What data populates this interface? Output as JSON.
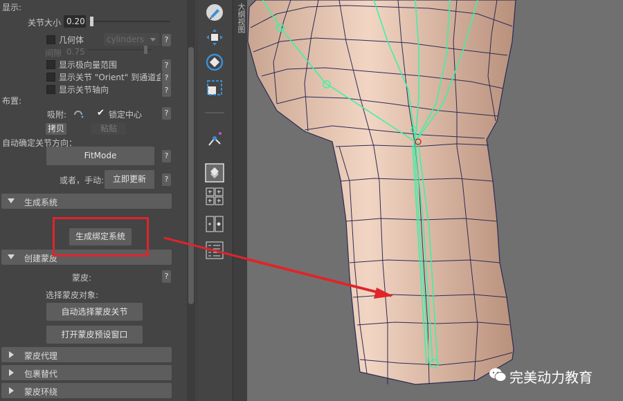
{
  "display": {
    "header": "显示:",
    "joint_size_label": "关节大小",
    "joint_size_value": "0.20",
    "geometry_label": "几何体",
    "geometry_value": "cylinders",
    "gap_label": "间隙",
    "gap_value": "0.75",
    "show_pole_label": "显示极向量范围",
    "show_orient_label": "显示关节 \"Orient\" 到通道盒",
    "show_axis_label": "显示关节轴向"
  },
  "layout": {
    "header": "布置:",
    "snap_label": "吸附:",
    "lock_center_label": "锁定中心",
    "copy_label": "拷贝",
    "paste_label": "粘贴"
  },
  "auto_orient": {
    "header": "自动确定关节方向：",
    "fitmode_label": "FitMode",
    "or_manual_label": "或者，手动:",
    "update_now_label": "立即更新"
  },
  "sections": {
    "generate_system": "生成系统",
    "generate_rig_button": "生成绑定系统",
    "create_skin": "创建蒙皮",
    "skin_label": "蒙皮:",
    "select_skin_objects_label": "选择蒙皮对象:",
    "auto_select_joints_button": "自动选择蒙皮关节",
    "open_skin_preset_button": "打开蒙皮预设窗口",
    "skin_proxy": "蒙皮代理",
    "wrap_replace": "包裹替代",
    "skin_ring": "蒙皮环绕"
  },
  "help_glyph": "?",
  "side_tab_label": "大纲视图",
  "watermark": "完美动力教育",
  "colors": {
    "annotation_red": "#e0242a",
    "rig_green": "#3ff0a6",
    "skin": "#e8c9b4"
  }
}
